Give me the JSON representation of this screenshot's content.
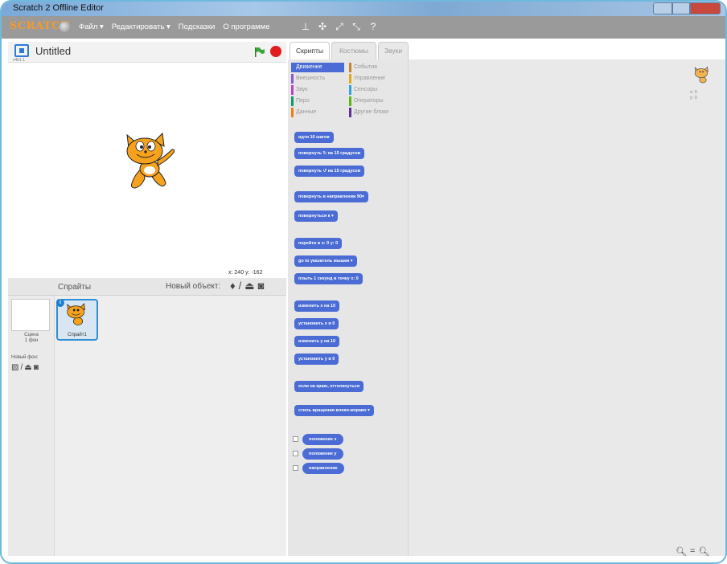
{
  "window": {
    "title": "Scratch 2 Offline Editor"
  },
  "menubar": {
    "logo": "SCRATCH",
    "items": [
      "Файл ▾",
      "Редактировать ▾",
      "Подсказки",
      "О программе"
    ],
    "tool_icons": [
      "duplicate-icon",
      "delete-icon",
      "grow-icon",
      "shrink-icon",
      "help-icon"
    ]
  },
  "stage": {
    "version": "v461.1",
    "project_title": "Untitled",
    "coords": {
      "x_label": "x:",
      "x_value": "240",
      "y_label": "y:",
      "y_value": "-162"
    }
  },
  "sprites": {
    "header": "Спрайты",
    "new_object_label": "Новый объект:",
    "stage_label": "Сцена",
    "stage_sub": "1 фон",
    "new_bg_label": "Новый фон:",
    "sprite_name": "Спрайт1"
  },
  "tabs": [
    "Скрипты",
    "Костюмы",
    "Звуки"
  ],
  "categories": [
    {
      "label": "Движение",
      "color": "#4a6cd4",
      "selected": true
    },
    {
      "label": "События",
      "color": "#c88330"
    },
    {
      "label": "Внешность",
      "color": "#8a55d7"
    },
    {
      "label": "Управление",
      "color": "#e1a91a"
    },
    {
      "label": "Звук",
      "color": "#bb42c3"
    },
    {
      "label": "Сенсоры",
      "color": "#2ca5e2"
    },
    {
      "label": "Перо",
      "color": "#0e9a6c"
    },
    {
      "label": "Операторы",
      "color": "#5cb712"
    },
    {
      "label": "Данные",
      "color": "#ee7d16"
    },
    {
      "label": "Другие блоки",
      "color": "#632d99"
    }
  ],
  "blocks": [
    "идти 10 шагов",
    "повернуть ↻ на 15 градусов",
    "повернуть ↺ на 15 градусов",
    "повернуть в направлении 90▾",
    "повернуться к ▾",
    "перейти в x: 0 y: 0",
    "go to указатель мышки ▾",
    "плыть 1 секунд в точку x: 0",
    "изменить x на 10",
    "установить x в 0",
    "изменить y на 10",
    "установить y в 0",
    "если на краю, оттолкнуться",
    "стиль вращения влево-вправо ▾"
  ],
  "reporters": [
    "положение x",
    "положение y",
    "направление"
  ],
  "sprite_info": {
    "x": "x: 0",
    "y": "y: 0"
  },
  "zoom_icons": [
    "zoom-out-icon",
    "zoom-reset-icon",
    "zoom-in-icon"
  ]
}
